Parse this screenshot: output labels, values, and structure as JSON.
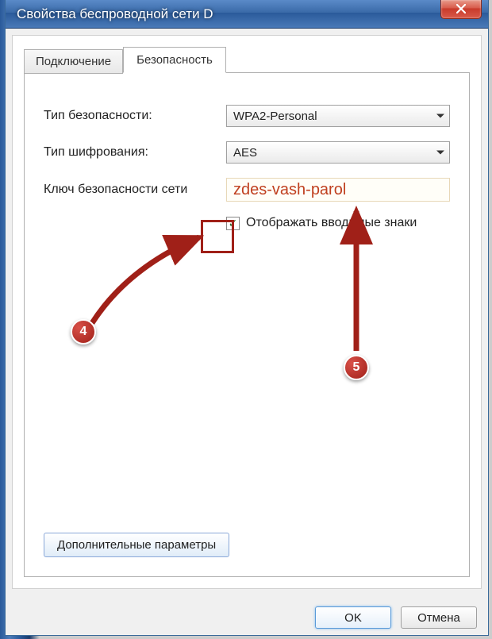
{
  "window": {
    "title": "Свойства беспроводной сети D"
  },
  "tabs": {
    "connection": "Подключение",
    "security": "Безопасность"
  },
  "form": {
    "security_type_label": "Тип безопасности:",
    "security_type_value": "WPA2-Personal",
    "encryption_label": "Тип шифрования:",
    "encryption_value": "AES",
    "key_label": "Ключ безопасности сети",
    "key_value": "zdes-vash-parol",
    "show_chars_label": "Отображать вводимые знаки",
    "show_chars_checked": true
  },
  "buttons": {
    "advanced": "Дополнительные параметры",
    "ok": "OK",
    "cancel": "Отмена"
  },
  "annotations": {
    "marker4": "4",
    "marker5": "5"
  }
}
